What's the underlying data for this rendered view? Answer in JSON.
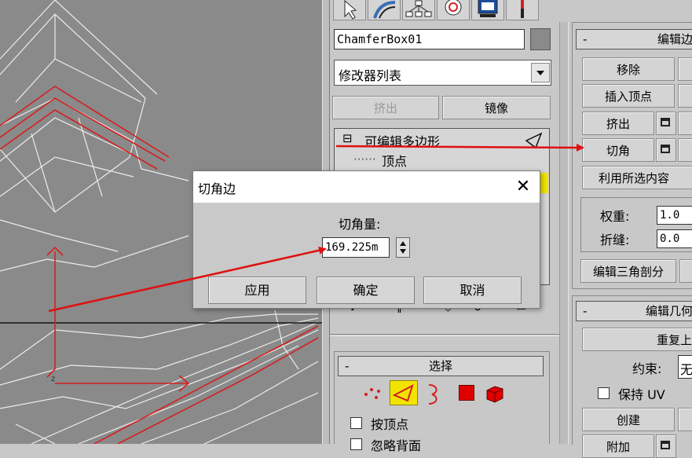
{
  "viewport": {
    "description_none": ""
  },
  "command_panel": {
    "tab_icons": [
      "pointer-icon",
      "curve-icon",
      "hierarchy-icon",
      "motion-icon",
      "display-icon",
      "utilities-icon"
    ],
    "object_name": "ChamferBox01",
    "object_color": "#8a8a8a",
    "modifier_list": "修改器列表",
    "extrude_label": "挤出",
    "mirror_label": "镜像",
    "stack": {
      "root": "可编辑多边形",
      "sub": "顶点"
    },
    "select_rollout": {
      "title": "选择",
      "by_vertex": "按顶点",
      "ignore_backface": "忽略背面"
    }
  },
  "edit_edges": {
    "title": "编辑边",
    "remove": "移除",
    "insert_vertex": "插入顶点",
    "extrude": "挤出",
    "chamfer": "切角",
    "create_shape": "利用所选内容",
    "weight_label": "权重:",
    "weight_value": "1.0",
    "crease_label": "折缝:",
    "crease_value": "0.0",
    "edit_tri": "编辑三角剖分"
  },
  "edit_geometry": {
    "title": "编辑几何",
    "repeat_last": "重复上一",
    "constraint_label": "约束:",
    "constraint_value": "无",
    "preserve_uv": "保持 UV",
    "create": "创建",
    "attach": "附加"
  },
  "dialog": {
    "title": "切角边",
    "amount_label": "切角量:",
    "amount_value": "169.225m",
    "apply": "应用",
    "ok": "确定",
    "cancel": "取消",
    "close_glyph": "✕"
  },
  "colors": {
    "annotation_arrow": "#e01010",
    "selected_edge": "#d42020",
    "wire": "#ececec",
    "highlight_yellow": "#f2e400"
  }
}
